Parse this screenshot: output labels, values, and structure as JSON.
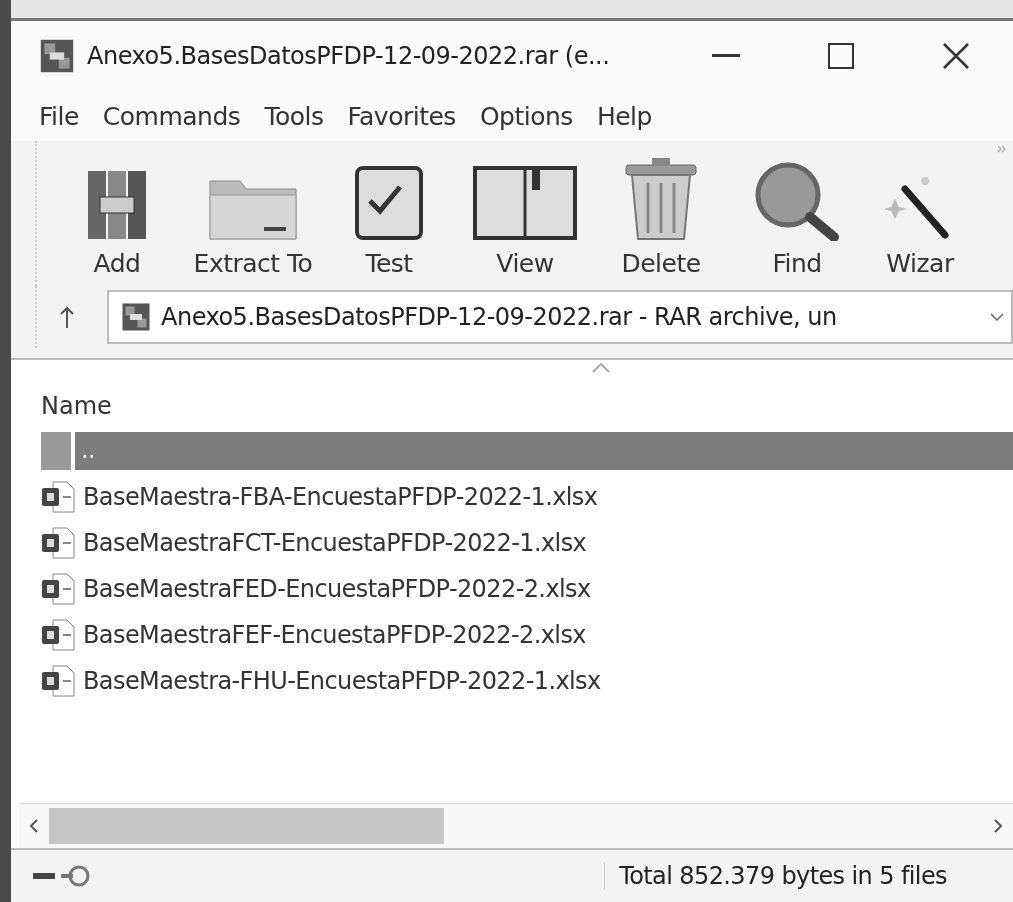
{
  "window": {
    "title": "Anexo5.BasesDatosPFDP-12-09-2022.rar (e..."
  },
  "menu": [
    "File",
    "Commands",
    "Tools",
    "Favorites",
    "Options",
    "Help"
  ],
  "toolbar": [
    {
      "label": "Add",
      "kind": "add"
    },
    {
      "label": "Extract To",
      "kind": "extract"
    },
    {
      "label": "Test",
      "kind": "test"
    },
    {
      "label": "View",
      "kind": "view"
    },
    {
      "label": "Delete",
      "kind": "delete"
    },
    {
      "label": "Find",
      "kind": "find"
    },
    {
      "label": "Wizar",
      "kind": "wizard"
    }
  ],
  "address": {
    "value": "Anexo5.BasesDatosPFDP-12-09-2022.rar - RAR archive, un"
  },
  "file_list": {
    "columns": [
      "Name"
    ],
    "rows": [
      {
        "name": "..",
        "kind": "parent",
        "selected": true
      },
      {
        "name": "BaseMaestra-FBA-EncuestaPFDP-2022-1.xlsx",
        "kind": "file",
        "selected": false
      },
      {
        "name": "BaseMaestraFCT-EncuestaPFDP-2022-1.xlsx",
        "kind": "file",
        "selected": false
      },
      {
        "name": "BaseMaestraFED-EncuestaPFDP-2022-2.xlsx",
        "kind": "file",
        "selected": false
      },
      {
        "name": "BaseMaestraFEF-EncuestaPFDP-2022-2.xlsx",
        "kind": "file",
        "selected": false
      },
      {
        "name": "BaseMaestra-FHU-EncuestaPFDP-2022-1.xlsx",
        "kind": "file",
        "selected": false
      }
    ]
  },
  "status_bar": {
    "text": "Total 852.379 bytes in 5 files"
  }
}
